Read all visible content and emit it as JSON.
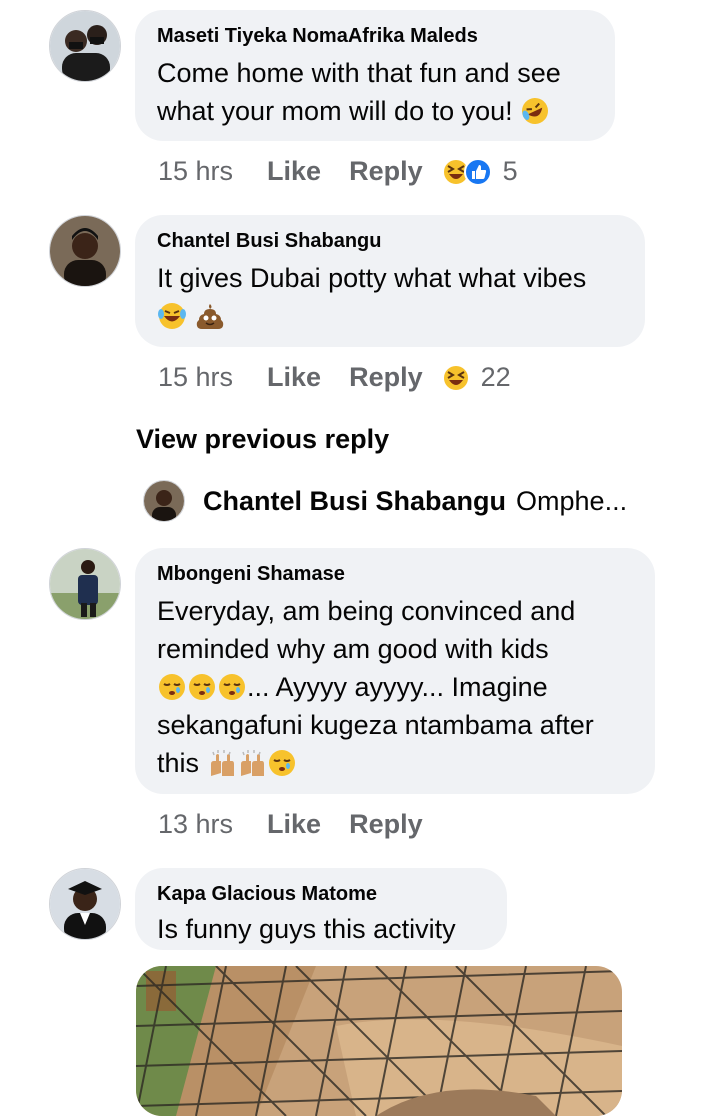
{
  "comments": [
    {
      "name": "Maseti Tiyeka NomaAfrika Maleds",
      "lines": [
        "Come home with that fun and see",
        "what your mom will do to you!"
      ],
      "time": "15 hrs",
      "like_label": "Like",
      "reply_label": "Reply",
      "reaction_icons": [
        "laughing-face-icon",
        "thumbs-up-icon"
      ],
      "reaction_count": "5"
    },
    {
      "name": "Chantel Busi Shabangu",
      "lines": [
        "It gives Dubai potty what what vibes"
      ],
      "emoji_line": [
        "tears-of-joy-emoji",
        "poop-emoji"
      ],
      "time": "15 hrs",
      "like_label": "Like",
      "reply_label": "Reply",
      "reaction_icons": [
        "laughing-face-icon"
      ],
      "reaction_count": "22"
    },
    {
      "name": "Mbongeni Shamase",
      "lines": [
        "Everyday, am being convinced and",
        "reminded why am good with kids",
        "... Ayyyy ayyyy... Imagine",
        "sekangafuni kugeza ntambama after",
        "this"
      ],
      "time": "13 hrs",
      "like_label": "Like",
      "reply_label": "Reply"
    },
    {
      "name": "Kapa Glacious Matome",
      "lines": [
        "Is funny guys this activity"
      ]
    }
  ],
  "view_previous": "View previous reply",
  "reply_preview": {
    "name": "Chantel Busi Shabangu",
    "text": "Omphe..."
  },
  "colors": {
    "bubble": "#f0f2f5",
    "meta_text": "#65676b",
    "primary_text": "#050505",
    "like_blue": "#1877f2"
  }
}
